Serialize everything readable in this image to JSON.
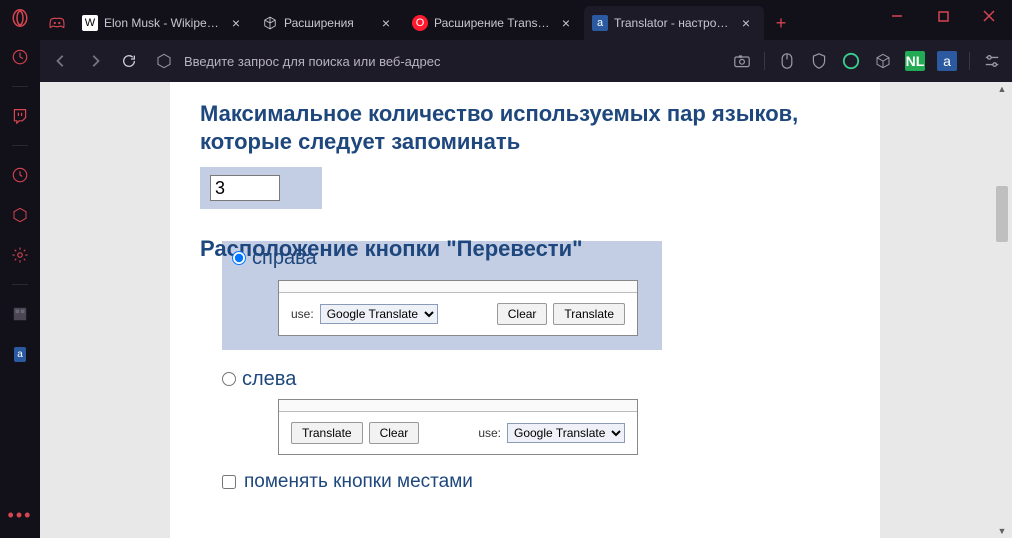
{
  "window": {
    "tabs": [
      {
        "label": "Elon Musk - Wikipedia",
        "favicon": "W",
        "active": false
      },
      {
        "label": "Расширения",
        "favicon": "cube",
        "active": false
      },
      {
        "label": "Расширение Translator",
        "favicon": "opera",
        "active": false
      },
      {
        "label": "Translator - настройки",
        "favicon": "translator",
        "active": true
      }
    ]
  },
  "toolbar": {
    "placeholder": "Введите запрос для поиска или веб-адрес"
  },
  "page": {
    "heading_max": "Максимальное количество используемых пар языков, которые следует запоминать",
    "max_value": "3",
    "heading_layout": "Расположение кнопки \"Перевести\"",
    "opt_right": "справа",
    "opt_left": "слева",
    "use_label": "use:",
    "translator_options": [
      "Google Translate"
    ],
    "btn_clear": "Clear",
    "btn_translate": "Translate",
    "swap_label": "поменять кнопки местами"
  }
}
